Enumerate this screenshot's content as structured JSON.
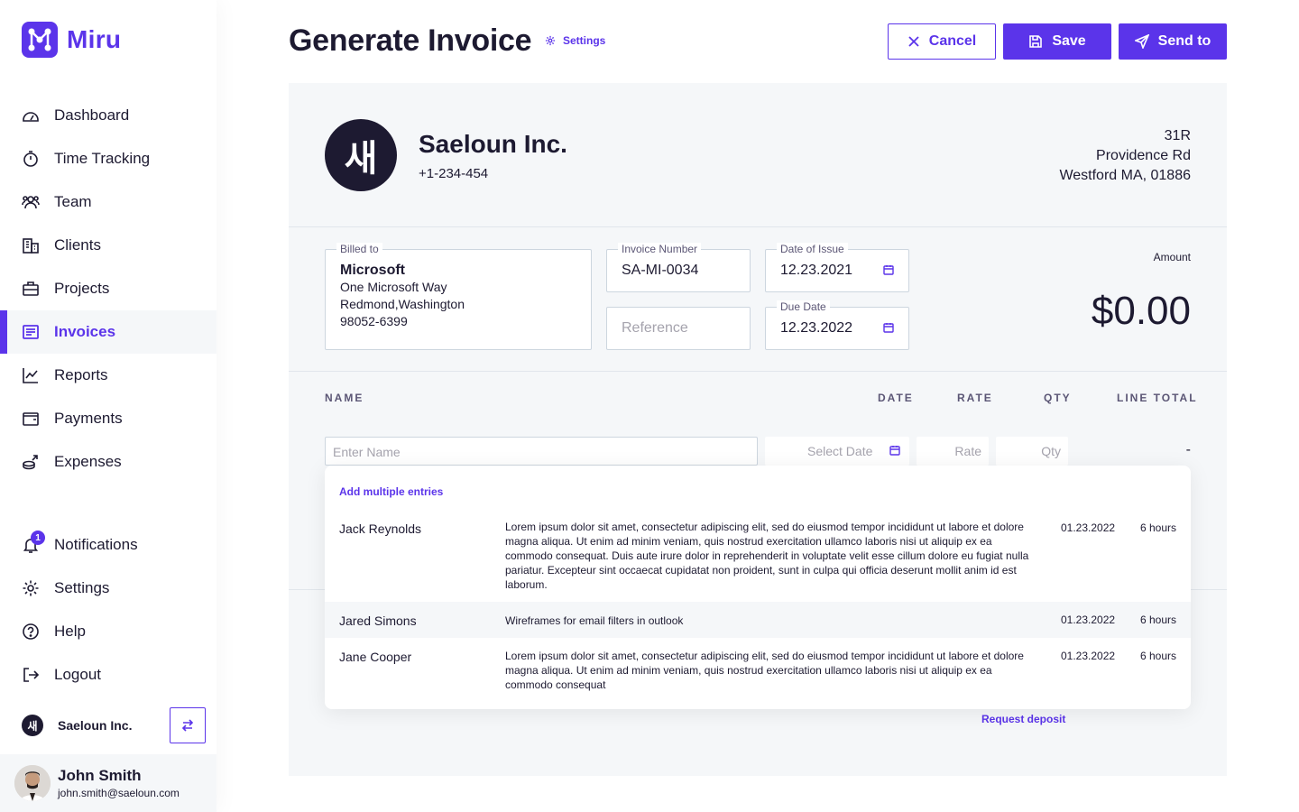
{
  "app": {
    "name": "Miru",
    "brand_color": "#5b34ea"
  },
  "sidebar": {
    "items": [
      {
        "label": "Dashboard",
        "icon": "dashboard-icon",
        "active": false
      },
      {
        "label": "Time Tracking",
        "icon": "stopwatch-icon",
        "active": false
      },
      {
        "label": "Team",
        "icon": "team-icon",
        "active": false
      },
      {
        "label": "Clients",
        "icon": "building-icon",
        "active": false
      },
      {
        "label": "Projects",
        "icon": "briefcase-icon",
        "active": false
      },
      {
        "label": "Invoices",
        "icon": "invoice-icon",
        "active": true
      },
      {
        "label": "Reports",
        "icon": "chart-line-icon",
        "active": false
      },
      {
        "label": "Payments",
        "icon": "wallet-icon",
        "active": false
      },
      {
        "label": "Expenses",
        "icon": "coins-icon",
        "active": false
      }
    ],
    "bottom_items": [
      {
        "label": "Notifications",
        "icon": "bell-icon",
        "badge": "1"
      },
      {
        "label": "Settings",
        "icon": "gear-icon"
      },
      {
        "label": "Help",
        "icon": "help-icon"
      },
      {
        "label": "Logout",
        "icon": "logout-icon"
      }
    ],
    "workspace": {
      "avatar": "새",
      "name": "Saeloun Inc."
    },
    "user": {
      "name": "John Smith",
      "email": "john.smith@saeloun.com"
    }
  },
  "header": {
    "title": "Generate Invoice",
    "settings_label": "Settings",
    "cancel_label": "Cancel",
    "save_label": "Save",
    "send_label": "Send to"
  },
  "invoice": {
    "company": {
      "avatar": "새",
      "name": "Saeloun Inc.",
      "phone": "+1-234-454",
      "address": [
        "31R",
        "Providence Rd",
        "Westford MA, 01886"
      ]
    },
    "billed_to": {
      "label": "Billed to",
      "name": "Microsoft",
      "lines": [
        "One Microsoft Way",
        "Redmond,Washington",
        "98052-6399"
      ]
    },
    "invoice_number": {
      "label": "Invoice Number",
      "value": "SA-MI-0034"
    },
    "reference": {
      "placeholder": "Reference"
    },
    "date_of_issue": {
      "label": "Date of Issue",
      "value": "12.23.2021"
    },
    "due_date": {
      "label": "Due Date",
      "value": "12.23.2022"
    },
    "amount": {
      "label": "Amount",
      "value": "$0.00"
    },
    "columns": {
      "name": "NAME",
      "date": "DATE",
      "rate": "RATE",
      "qty": "QTY",
      "line_total": "LINE TOTAL"
    },
    "new_line": {
      "name_placeholder": "Enter Name",
      "date_placeholder": "Select Date",
      "rate_placeholder": "Rate",
      "qty_placeholder": "Qty",
      "total": "-"
    },
    "request_deposit": "Request deposit"
  },
  "dropdown": {
    "add_multiple": "Add multiple entries",
    "entries": [
      {
        "name": "Jack Reynolds",
        "description": "Lorem ipsum dolor sit amet, consectetur adipiscing elit, sed do eiusmod tempor incididunt ut labore et dolore magna aliqua. Ut enim ad minim veniam, quis nostrud exercitation  ullamco laboris nisi ut aliquip ex ea commodo consequat. Duis aute irure dolor in reprehenderit in voluptate velit esse cillum dolore eu fugiat nulla pariatur. Excepteur sint  occaecat cupidatat non proident, sunt in culpa qui officia deserunt mollit anim id est laborum.",
        "date": "01.23.2022",
        "hours": "6 hours"
      },
      {
        "name": "Jared Simons",
        "description": "Wireframes for email filters in outlook",
        "date": "01.23.2022",
        "hours": "6 hours"
      },
      {
        "name": "Jane Cooper",
        "description": "Lorem ipsum dolor sit amet, consectetur adipiscing elit, sed do eiusmod tempor incididunt ut labore et dolore magna aliqua. Ut enim ad minim veniam, quis nostrud exercitation  ullamco laboris nisi ut aliquip ex ea commodo consequat",
        "date": "01.23.2022",
        "hours": "6 hours"
      }
    ]
  }
}
